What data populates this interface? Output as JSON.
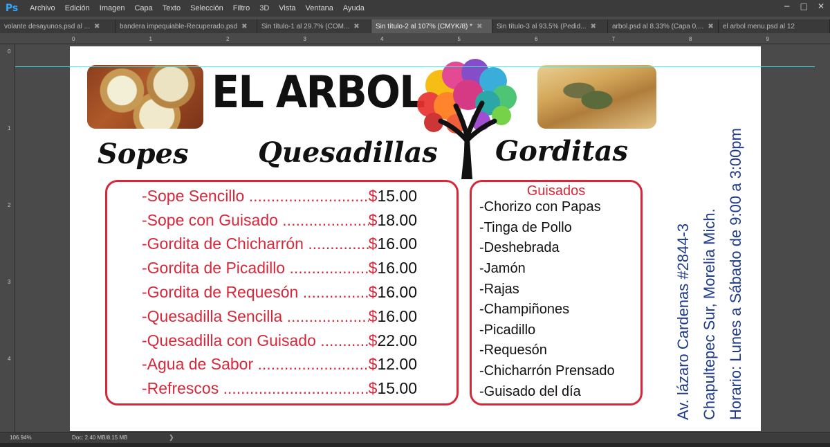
{
  "app": {
    "logo": "Ps",
    "menu": [
      "Archivo",
      "Edición",
      "Imagen",
      "Capa",
      "Texto",
      "Selección",
      "Filtro",
      "3D",
      "Vista",
      "Ventana",
      "Ayuda"
    ],
    "window_controls": [
      "−",
      "□",
      "✕"
    ]
  },
  "tabs": [
    {
      "label": "volante desayunos.psd al ...",
      "close": "✖",
      "active": false
    },
    {
      "label": "bandera impequiable-Recuperado.psd",
      "close": "✖",
      "active": false
    },
    {
      "label": "Sin título-1 al 29.7% (COM...",
      "close": "✖",
      "active": false
    },
    {
      "label": "Sin título-2 al 107% (CMYK/8) *",
      "close": "✖",
      "active": true
    },
    {
      "label": "Sin título-3 al 93.5% (Pedid...",
      "close": "✖",
      "active": false
    },
    {
      "label": "arbol.psd al 8.33% (Capa 0,...",
      "close": "✖",
      "active": false
    },
    {
      "label": "el arbol  menu.psd al 12",
      "close": "",
      "active": false
    }
  ],
  "rulers": {
    "horizontal": [
      "0",
      "1",
      "2",
      "3",
      "4",
      "5",
      "6",
      "7",
      "8",
      "9"
    ],
    "vertical": [
      "0",
      "1",
      "2",
      "3",
      "4"
    ]
  },
  "menu_card": {
    "title": "EL ARBOL",
    "categories": {
      "sopes": "Sopes",
      "quesadillas": "Quesadillas",
      "gorditas": "Gorditas"
    },
    "prices": [
      {
        "item": "-Sope Sencillo",
        "dollar": "$",
        "amount": "15.00"
      },
      {
        "item": "-Sope con Guisado",
        "dollar": "$",
        "amount": "18.00"
      },
      {
        "item": "-Gordita de Chicharrón",
        "dollar": "$",
        "amount": "16.00"
      },
      {
        "item": "-Gordita de Picadillo",
        "dollar": "$",
        "amount": "16.00"
      },
      {
        "item": "-Gordita de Requesón",
        "dollar": "$",
        "amount": "16.00"
      },
      {
        "item": "-Quesadilla Sencilla",
        "dollar": "$",
        "amount": "16.00"
      },
      {
        "item": "-Quesadilla con Guisado",
        "dollar": "$",
        "amount": "22.00"
      },
      {
        "item": "-Agua de Sabor",
        "dollar": "$",
        "amount": "12.00"
      },
      {
        "item": "-Refrescos",
        "dollar": "$",
        "amount": "15.00"
      }
    ],
    "guisados_title": "Guisados",
    "guisados": [
      "-Chorizo con Papas",
      "-Tinga de Pollo",
      "-Deshebrada",
      "-Jamón",
      "-Rajas",
      "-Champiñones",
      "-Picadillo",
      "-Requesón",
      "-Chicharrón Prensado",
      "-Guisado del día"
    ],
    "address_line1": "Av. lázaro Cardenas #2844-3",
    "address_line2": "Chapultepec Sur, Morelia Mich.",
    "hours": "Horario: Lunes a Sábado de 9:00 a 3:00pm",
    "colors": {
      "accent_red": "#d6283a",
      "info_blue": "#1e3a8a"
    }
  },
  "status": {
    "zoom": "106.94%",
    "doc": "Doc: 2.40 MB/8.15 MB",
    "arrow": "❯"
  }
}
